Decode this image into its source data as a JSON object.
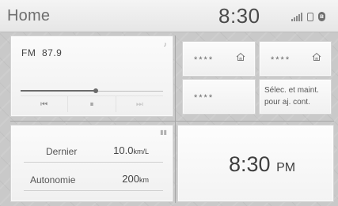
{
  "header": {
    "title": "Home",
    "clock": "8:30",
    "bluetooth_glyph": "ʙ"
  },
  "radio": {
    "band": "FM",
    "frequency": "87.9",
    "progress": 0.53,
    "controls": [
      {
        "name": "seek-back-button",
        "glyph": "⏮"
      },
      {
        "name": "pause-button",
        "glyph": "⏸"
      },
      {
        "name": "seek-forward-button",
        "glyph": "⏭"
      }
    ]
  },
  "presets": [
    {
      "label": "****"
    },
    {
      "label": "****"
    },
    {
      "label": "****"
    }
  ],
  "preset_hint": [
    "Sélec. et maint.",
    "pour aj. cont."
  ],
  "economy": {
    "last_label": "Dernier",
    "last_value": "10.0",
    "last_unit": "km/L",
    "range_label": "Autonomie",
    "range_value": "200",
    "range_unit": "km"
  },
  "clock_tile": {
    "time": "8:30",
    "ampm": "PM"
  }
}
